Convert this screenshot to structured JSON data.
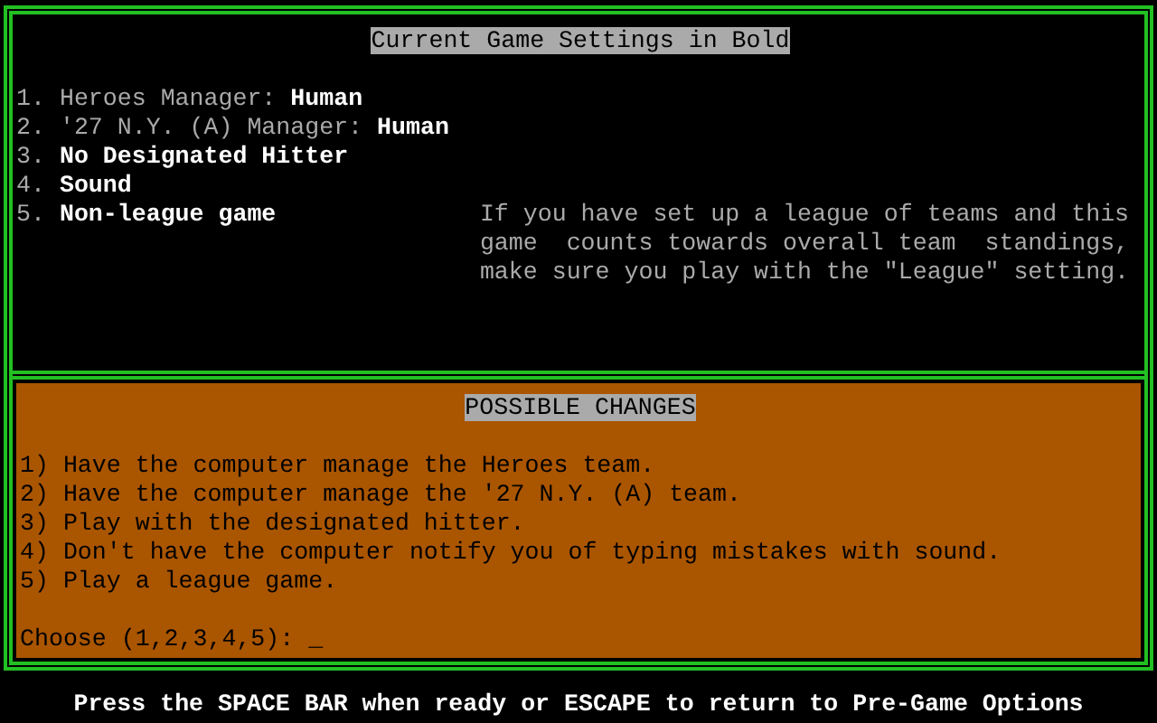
{
  "settings": {
    "title": "Current Game Settings in Bold",
    "items": [
      {
        "number": "1.",
        "label": "Heroes Manager:",
        "bold": false,
        "value": "Human"
      },
      {
        "number": "2.",
        "label": "'27 N.Y. (A) Manager:",
        "bold": false,
        "value": "Human"
      },
      {
        "number": "3.",
        "label": "No Designated Hitter",
        "bold": true
      },
      {
        "number": "4.",
        "label": "Sound",
        "bold": true
      },
      {
        "number": "5.",
        "label": "Non-league game",
        "bold": true
      }
    ],
    "hint": [
      "If you have set up a league of teams and this",
      "game  counts towards overall team  standings,",
      "make sure you play with the \"League\" setting."
    ]
  },
  "changes": {
    "title": "POSSIBLE CHANGES",
    "options": [
      "1) Have the computer manage the Heroes team.",
      "2) Have the computer manage the '27 N.Y. (A) team.",
      "3) Play with the designated hitter.",
      "4) Don't have the computer notify you of typing mistakes with sound.",
      "5) Play a league game."
    ],
    "prompt": "Choose (1,2,3,4,5):",
    "cursor": "_"
  },
  "status_bar": "Press the SPACE BAR when ready or ESCAPE to return to Pre-Game Options"
}
